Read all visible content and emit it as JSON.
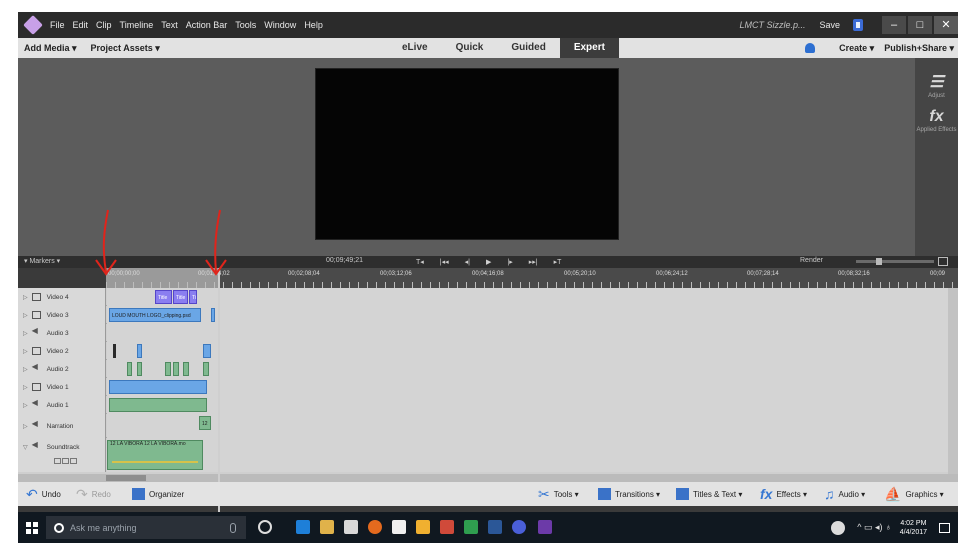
{
  "menu": [
    "File",
    "Edit",
    "Clip",
    "Timeline",
    "Text",
    "Action Bar",
    "Tools",
    "Window",
    "Help"
  ],
  "titlebar": {
    "project": "LMCT Sizzle.p...",
    "save": "Save",
    "minimize": "–",
    "maximize": "□",
    "close": "✕"
  },
  "toolbar": {
    "add_media": "Add Media ▾",
    "project_assets": "Project Assets ▾",
    "create": "Create ▾",
    "publish": "Publish+Share ▾"
  },
  "modes": [
    "eLive",
    "Quick",
    "Guided",
    "Expert"
  ],
  "right_panel": {
    "adjust": "Adjust",
    "fx": "fx",
    "applied_effects": "Applied Effects"
  },
  "timeline": {
    "markers": "▾ Markers ▾",
    "timecode": "00;09;49;21",
    "render": "Render",
    "transport": [
      "T◂",
      "|◂◂",
      "◂|",
      "▶",
      "|▸",
      "▸▸|",
      "▸T"
    ],
    "ruler": [
      "00;00;00;00",
      "00;01;04;02",
      "00;02;08;04",
      "00;03;12;06",
      "00;04;16;08",
      "00;05;20;10",
      "00;06;24;12",
      "00;07;28;14",
      "00;08;32;16",
      "00;09"
    ]
  },
  "tracks": [
    {
      "name": "Video 4",
      "type": "video"
    },
    {
      "name": "Video 3",
      "type": "video"
    },
    {
      "name": "Audio 3",
      "type": "audio"
    },
    {
      "name": "Video 2",
      "type": "video"
    },
    {
      "name": "Audio 2",
      "type": "audio"
    },
    {
      "name": "Video 1",
      "type": "video"
    },
    {
      "name": "Audio 1",
      "type": "audio"
    },
    {
      "name": "Narration",
      "type": "narration"
    }
  ],
  "soundtrack": {
    "name": "Soundtrack",
    "clip_label": "12 LA VIBORA    12 LA VIBORA.mo"
  },
  "clips": {
    "title1": "Title",
    "title2": "Title",
    "title3": "Ti",
    "loud": "LOUD MOUTH LOGO_clipping.psd",
    "narr": "12"
  },
  "action_bar": {
    "undo": "Undo",
    "redo": "Redo",
    "organizer": "Organizer",
    "tools": "Tools ▾",
    "transitions": "Transitions ▾",
    "titles": "Titles & Text ▾",
    "effects": "Effects ▾",
    "audio": "Audio ▾",
    "graphics": "Graphics ▾"
  },
  "taskbar": {
    "search_placeholder": "Ask me anything",
    "time": "4:02 PM",
    "date": "4/4/2017"
  },
  "colors": {
    "title_clip": "#8a7ef0",
    "video_clip": "#6aa6e6",
    "audio_clip": "#7fb98f",
    "annotation": "#e0241b"
  }
}
